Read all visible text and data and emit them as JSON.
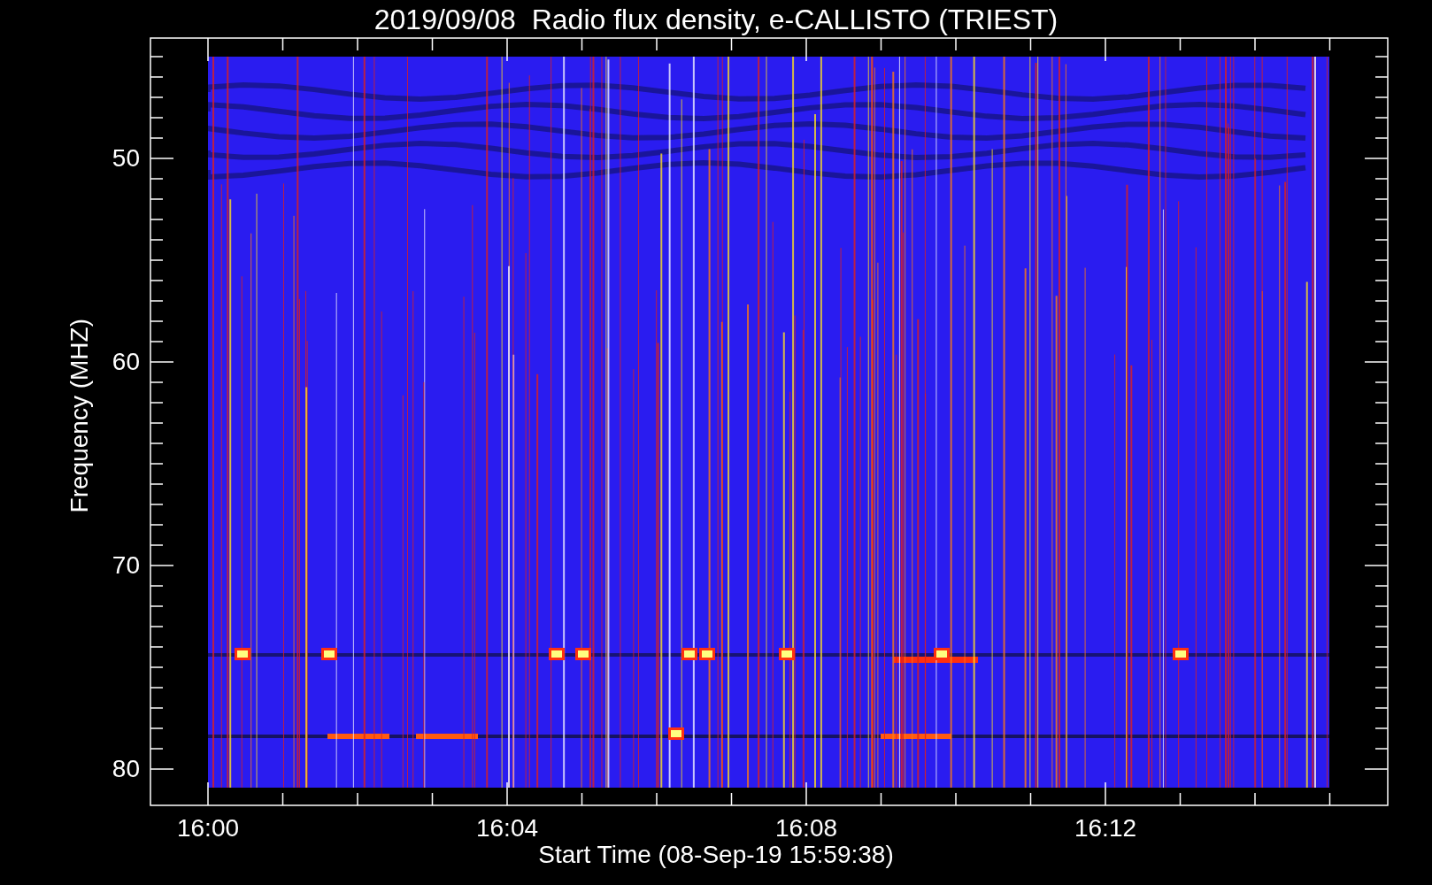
{
  "title": "2019/09/08  Radio flux density, e-CALLISTO (TRIEST)",
  "y_axis": {
    "label": "Frequency (MHZ)",
    "ticks": [
      "50",
      "60",
      "70",
      "80"
    ]
  },
  "x_axis": {
    "label": "Start Time (08-Sep-19 15:59:38)",
    "ticks": [
      "16:00",
      "16:04",
      "16:08",
      "16:12"
    ]
  }
}
